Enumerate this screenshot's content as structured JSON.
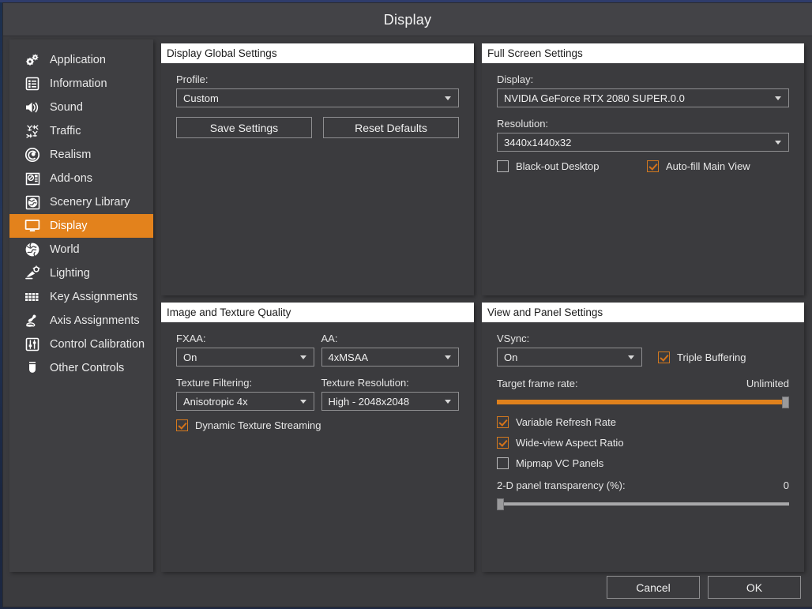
{
  "window": {
    "title": "Display"
  },
  "sidebar": {
    "items": [
      {
        "label": "Application",
        "icon": "gears-icon",
        "selected": false
      },
      {
        "label": "Information",
        "icon": "list-document-icon",
        "selected": false
      },
      {
        "label": "Sound",
        "icon": "speaker-icon",
        "selected": false
      },
      {
        "label": "Traffic",
        "icon": "aircraft-traffic-icon",
        "selected": false
      },
      {
        "label": "Realism",
        "icon": "spiral-gauge-icon",
        "selected": false
      },
      {
        "label": "Add-ons",
        "icon": "package-box-icon",
        "selected": false
      },
      {
        "label": "Scenery Library",
        "icon": "globe-frame-icon",
        "selected": false
      },
      {
        "label": "Display",
        "icon": "monitor-icon",
        "selected": true
      },
      {
        "label": "World",
        "icon": "globe-icon",
        "selected": false
      },
      {
        "label": "Lighting",
        "icon": "lamp-icon",
        "selected": false
      },
      {
        "label": "Key Assignments",
        "icon": "keyboard-icon",
        "selected": false
      },
      {
        "label": "Axis Assignments",
        "icon": "joystick-icon",
        "selected": false
      },
      {
        "label": "Control Calibration",
        "icon": "sliders-icon",
        "selected": false
      },
      {
        "label": "Other Controls",
        "icon": "yoke-icon",
        "selected": false
      }
    ]
  },
  "panels": {
    "global": {
      "header": "Display Global Settings",
      "profile_label": "Profile:",
      "profile_value": "Custom",
      "save_label": "Save Settings",
      "reset_label": "Reset Defaults"
    },
    "fullscreen": {
      "header": "Full Screen Settings",
      "display_label": "Display:",
      "display_value": "NVIDIA GeForce RTX 2080 SUPER.0.0",
      "resolution_label": "Resolution:",
      "resolution_value": "3440x1440x32",
      "blackout_label": "Black-out Desktop",
      "blackout_checked": false,
      "autofill_label": "Auto-fill Main View",
      "autofill_checked": true
    },
    "texture": {
      "header": "Image and Texture Quality",
      "fxaa_label": "FXAA:",
      "fxaa_value": "On",
      "aa_label": "AA:",
      "aa_value": "4xMSAA",
      "filtering_label": "Texture Filtering:",
      "filtering_value": "Anisotropic 4x",
      "resolution_label": "Texture Resolution:",
      "resolution_value": "High - 2048x2048",
      "streaming_label": "Dynamic Texture Streaming",
      "streaming_checked": true
    },
    "view": {
      "header": "View and Panel Settings",
      "vsync_label": "VSync:",
      "vsync_value": "On",
      "triple_buffering_label": "Triple Buffering",
      "triple_buffering_checked": true,
      "framerate_label": "Target frame rate:",
      "framerate_value": "Unlimited",
      "framerate_percent": 100,
      "vrr_label": "Variable Refresh Rate",
      "vrr_checked": true,
      "wideview_label": "Wide-view Aspect Ratio",
      "wideview_checked": true,
      "mipmap_label": "Mipmap VC Panels",
      "mipmap_checked": false,
      "transparency_label": "2-D panel transparency (%):",
      "transparency_value": "0",
      "transparency_percent": 0
    }
  },
  "footer": {
    "cancel_label": "Cancel",
    "ok_label": "OK"
  },
  "colors": {
    "accent": "#e3821c",
    "slider_fill": "#e0811c",
    "check": "#d4731a",
    "panel_bg": "#3b3b3e",
    "sidebar_bg": "#3f3f42",
    "titlebar_bg": "#434347"
  }
}
